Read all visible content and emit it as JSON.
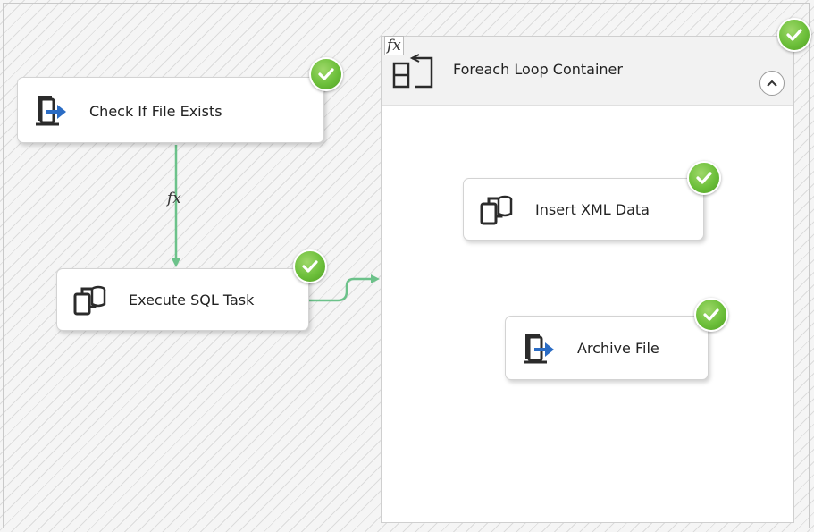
{
  "tasks": {
    "check_if_file_exists": {
      "label": "Check If File Exists",
      "icon": "file-system-task-icon",
      "status": "success-check-icon"
    },
    "execute_sql_task": {
      "label": "Execute SQL Task",
      "icon": "execute-sql-task-icon",
      "status": "success-check-icon"
    },
    "insert_xml_data": {
      "label": "Insert XML Data",
      "icon": "execute-sql-task-icon",
      "status": "success-check-icon"
    },
    "archive_file": {
      "label": "Archive File",
      "icon": "file-system-task-icon",
      "status": "success-check-icon"
    }
  },
  "container": {
    "title": "Foreach Loop Container",
    "expression_marker": "fx",
    "collapse_icon": "chevron-up-icon",
    "status": "success-check-icon"
  },
  "connectors": {
    "expression_marker": "fx"
  },
  "colors": {
    "precedence_success": "#6cc28a",
    "check_green": "#6cbf3a",
    "arrow_blue": "#2b6cc4",
    "icon_dark": "#2b2b2b"
  }
}
